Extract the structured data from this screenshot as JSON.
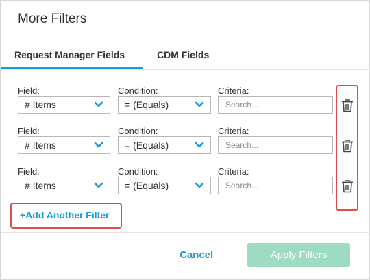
{
  "dialog": {
    "title": "More Filters"
  },
  "tabs": [
    {
      "label": "Request Manager Fields",
      "active": true
    },
    {
      "label": "CDM Fields",
      "active": false
    }
  ],
  "filters": [
    {
      "field_label": "Field:",
      "field_value": "# Items",
      "condition_label": "Condition:",
      "condition_value": "= (Equals)",
      "criteria_label": "Criteria:",
      "criteria_placeholder": "Search..."
    },
    {
      "field_label": "Field:",
      "field_value": "# Items",
      "condition_label": "Condition:",
      "condition_value": "= (Equals)",
      "criteria_label": "Criteria:",
      "criteria_placeholder": "Search..."
    },
    {
      "field_label": "Field:",
      "field_value": "# Items",
      "condition_label": "Condition:",
      "condition_value": "= (Equals)",
      "criteria_label": "Criteria:",
      "criteria_placeholder": "Search..."
    }
  ],
  "add_filter": {
    "label": "+Add Another Filter"
  },
  "footer": {
    "cancel_label": "Cancel",
    "apply_label": "Apply Filters"
  },
  "colors": {
    "accent": "#1a9ad6",
    "highlight": "#e24b4b",
    "apply_bg": "#9fdbc1"
  },
  "icons": {
    "dropdown": "chevron-down-icon",
    "delete": "trash-icon"
  }
}
